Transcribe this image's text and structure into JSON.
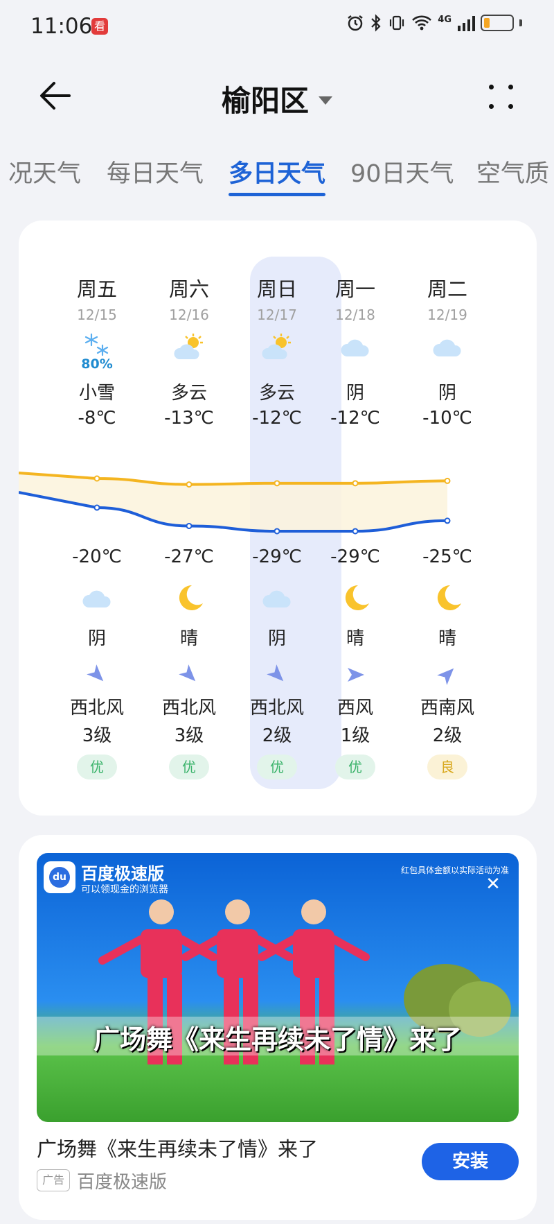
{
  "status_bar": {
    "time": "11:06",
    "notif_badge": "看",
    "network": "4G",
    "battery_level_percent": 20,
    "icons": [
      "alarm-icon",
      "bluetooth-icon",
      "vibrate-icon",
      "wifi-icon",
      "signal-icon",
      "battery-icon"
    ]
  },
  "header": {
    "title": "榆阳区",
    "back_icon": "arrow-left-icon",
    "more_icon": "more-dots-icon"
  },
  "tabs": [
    {
      "label": "况天气",
      "active": false
    },
    {
      "label": "每日天气",
      "active": false
    },
    {
      "label": "多日天气",
      "active": true
    },
    {
      "label": "90日天气",
      "active": false
    },
    {
      "label": "空气质",
      "active": false
    }
  ],
  "forecast": {
    "days": [
      {
        "dow": "周五",
        "date": "12/15",
        "day_icon": "snow-icon",
        "precip": "80%",
        "day_cond": "小雪",
        "high": "-8℃",
        "low": "-20℃",
        "night_icon": "cloud-icon",
        "night_cond": "阴",
        "wind_icon": "wind-direction-icon",
        "wind_dir": "西北风",
        "wind_level": "3级",
        "aqi": "优",
        "aqi_class": "good"
      },
      {
        "dow": "周六",
        "date": "12/16",
        "day_icon": "partly-cloudy-icon",
        "precip": "",
        "day_cond": "多云",
        "high": "-13℃",
        "low": "-27℃",
        "night_icon": "moon-icon",
        "night_cond": "晴",
        "wind_icon": "wind-direction-icon",
        "wind_dir": "西北风",
        "wind_level": "3级",
        "aqi": "优",
        "aqi_class": "good"
      },
      {
        "dow": "周日",
        "date": "12/17",
        "day_icon": "partly-cloudy-icon",
        "precip": "",
        "day_cond": "多云",
        "high": "-12℃",
        "low": "-29℃",
        "night_icon": "cloud-icon",
        "night_cond": "阴",
        "wind_icon": "wind-direction-icon",
        "wind_dir": "西北风",
        "wind_level": "2级",
        "aqi": "优",
        "aqi_class": "good"
      },
      {
        "dow": "周一",
        "date": "12/18",
        "day_icon": "cloud-icon",
        "precip": "",
        "day_cond": "阴",
        "high": "-12℃",
        "low": "-29℃",
        "night_icon": "moon-icon",
        "night_cond": "晴",
        "wind_icon": "wind-direction-icon",
        "wind_dir": "西风",
        "wind_level": "1级",
        "aqi": "优",
        "aqi_class": "good"
      },
      {
        "dow": "周二",
        "date": "12/19",
        "day_icon": "cloud-icon",
        "precip": "",
        "day_cond": "阴",
        "high": "-10℃",
        "low": "-25℃",
        "night_icon": "moon-icon",
        "night_cond": "晴",
        "wind_icon": "wind-direction-icon",
        "wind_dir": "西南风",
        "wind_level": "2级",
        "aqi": "良",
        "aqi_class": "fair"
      }
    ],
    "highs": [
      -8,
      -13,
      -12,
      -12,
      -10
    ],
    "lows": [
      -20,
      -27,
      -29,
      -29,
      -25
    ],
    "high_color": "#f4b521",
    "low_color": "#1e5ed8"
  },
  "ad": {
    "brand": "百度极速版",
    "slogan": "可以领现金的浏览器",
    "disclaimer": "红包具体金额以实际活动为准",
    "banner_text": "广场舞《来生再续未了情》来了",
    "headline": "广场舞《来生再续未了情》来了",
    "tag": "广告",
    "source": "百度极速版",
    "install_label": "安装",
    "close_glyph": "✕"
  }
}
